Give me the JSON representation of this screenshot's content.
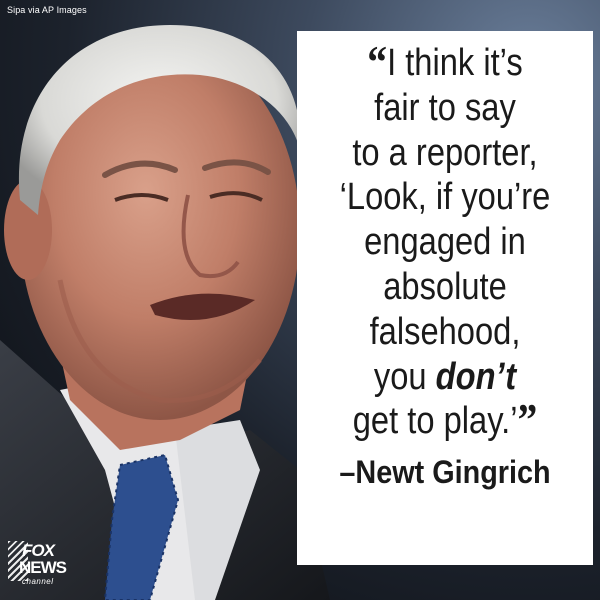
{
  "photo_credit": "Sipa via AP Images",
  "quote": {
    "lines": [
      "I think it’s",
      "fair to say",
      "to a reporter,",
      "‘Look, if you’re",
      "engaged in",
      "absolute",
      "falsehood,",
      "you ",
      "get to play.’"
    ],
    "emphasis": "don’t",
    "open_mark": "“",
    "close_mark": "”"
  },
  "attribution": "–Newt Gingrich",
  "logo": {
    "line1": "FOX",
    "line2": "NEWS",
    "line3": "channel"
  },
  "colors": {
    "quote_box": "#ffffff",
    "text": "#1a1a1a",
    "background_dark": "#1c222c"
  }
}
